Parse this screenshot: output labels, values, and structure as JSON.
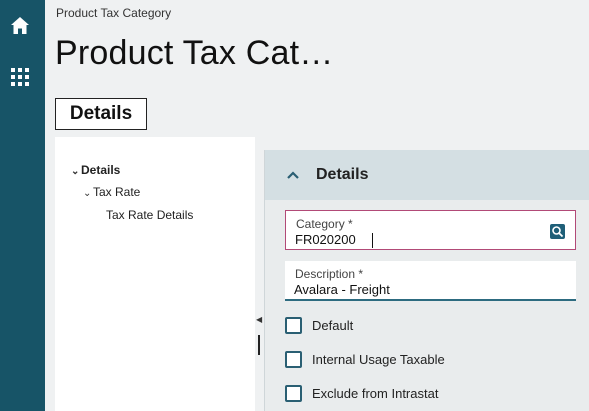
{
  "nav": {
    "home_icon": "home-icon",
    "apps_icon": "apps-grid-icon",
    "rail_color": "#175467"
  },
  "breadcrumb": "Product Tax Category",
  "page_title": "Product Tax Cat…",
  "tab": {
    "label": "Details"
  },
  "tree": {
    "items": [
      {
        "label": "Details",
        "expanded": true
      },
      {
        "label": "Tax Rate",
        "expanded": true
      },
      {
        "label": "Tax Rate Details"
      }
    ]
  },
  "panel": {
    "title": "Details",
    "category": {
      "label": "Category *",
      "value": "FR020200"
    },
    "description": {
      "label": "Description *",
      "value": "Avalara - Freight"
    },
    "checkboxes": [
      {
        "label": "Default",
        "checked": false
      },
      {
        "label": "Internal Usage Taxable",
        "checked": false
      },
      {
        "label": "Exclude from Intrastat",
        "checked": false
      }
    ]
  }
}
